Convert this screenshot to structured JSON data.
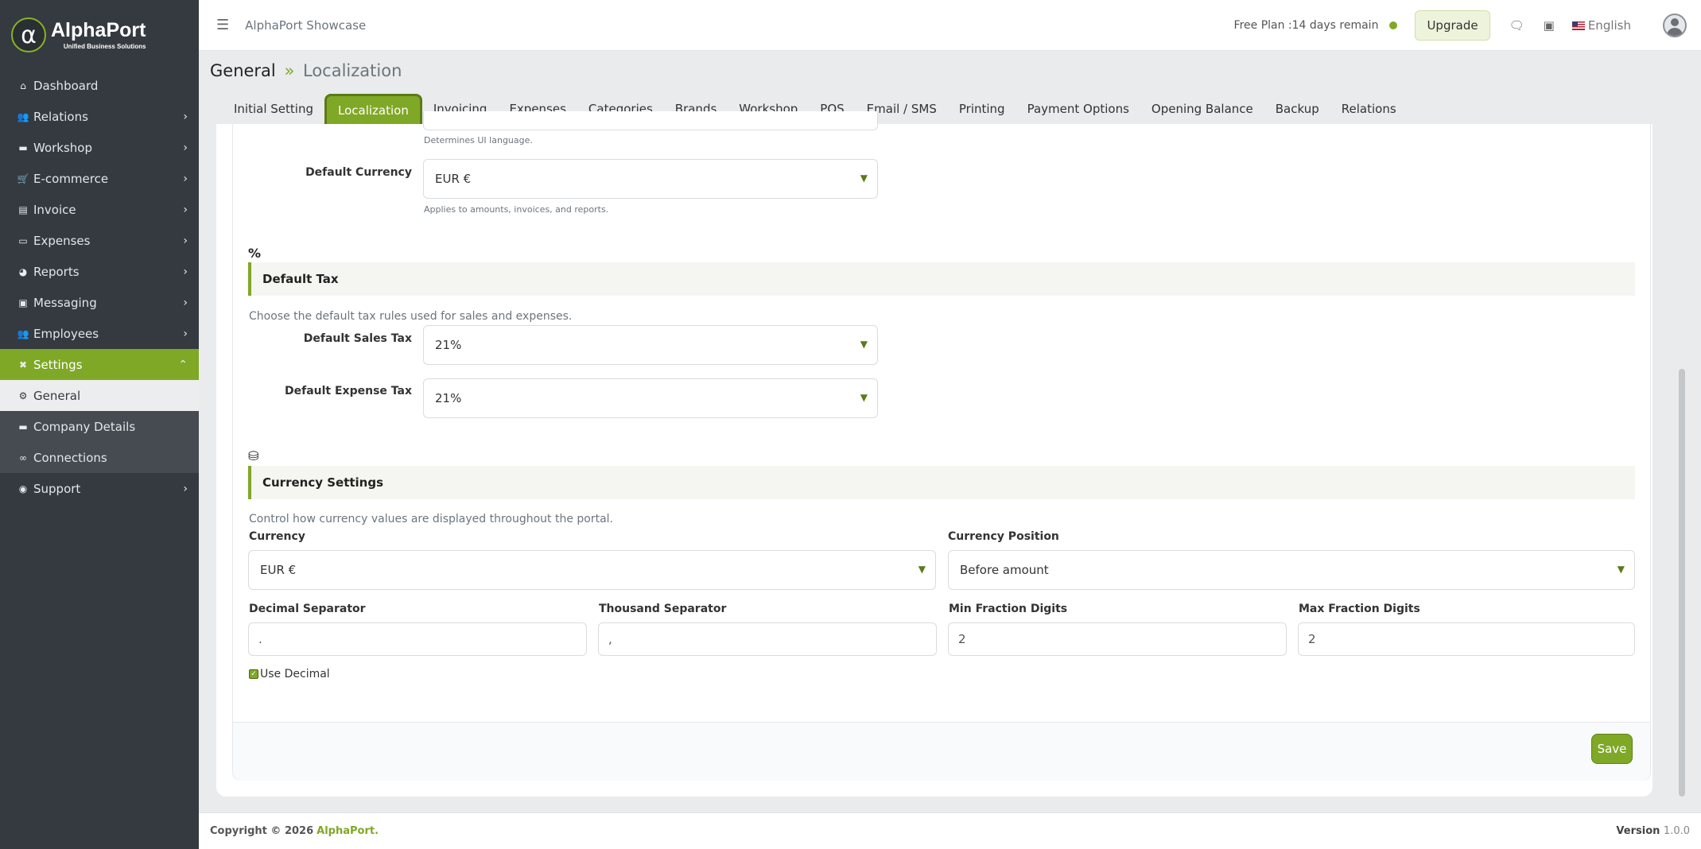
{
  "brand": {
    "title": "AlphaPort",
    "subtitle": "Unified Business Solutions"
  },
  "sidebar": {
    "items": [
      {
        "label": "Dashboard",
        "icon": "home-icon",
        "glyph": "⌂",
        "chevron": false
      },
      {
        "label": "Relations",
        "icon": "users-icon",
        "glyph": "👥",
        "chevron": true
      },
      {
        "label": "Workshop",
        "icon": "briefcase-icon",
        "glyph": "▬",
        "chevron": true
      },
      {
        "label": "E-commerce",
        "icon": "cart-icon",
        "glyph": "🛒",
        "chevron": true
      },
      {
        "label": "Invoice",
        "icon": "document-icon",
        "glyph": "▤",
        "chevron": true
      },
      {
        "label": "Expenses",
        "icon": "money-icon",
        "glyph": "▭",
        "chevron": true
      },
      {
        "label": "Reports",
        "icon": "pie-chart-icon",
        "glyph": "◕",
        "chevron": true
      },
      {
        "label": "Messaging",
        "icon": "message-icon",
        "glyph": "▣",
        "chevron": true
      },
      {
        "label": "Employees",
        "icon": "people-icon",
        "glyph": "👥",
        "chevron": true
      }
    ],
    "settings": {
      "label": "Settings",
      "icon": "tools-icon",
      "glyph": "✖"
    },
    "settings_sub": [
      {
        "label": "General",
        "icon": "gear-icon",
        "glyph": "⚙"
      },
      {
        "label": "Company Details",
        "icon": "briefcase-icon",
        "glyph": "▬"
      },
      {
        "label": "Connections",
        "icon": "link-icon",
        "glyph": "∞"
      }
    ],
    "support": {
      "label": "Support",
      "icon": "lifebuoy-icon",
      "glyph": "◉"
    }
  },
  "topbar": {
    "app_name": "AlphaPort Showcase",
    "plan_text": "Free Plan :14 days remain",
    "upgrade_label": "Upgrade",
    "language": "English"
  },
  "breadcrumb": {
    "parent": "General",
    "separator": "»",
    "current": "Localization"
  },
  "tabs": [
    "Initial Setting",
    "Localization",
    "Invoicing",
    "Expenses",
    "Categories",
    "Brands",
    "Workshop",
    "POS",
    "Email / SMS",
    "Printing",
    "Payment Options",
    "Opening Balance",
    "Backup",
    "Relations"
  ],
  "active_tab": "Localization",
  "form": {
    "language_hint": "Determines UI language.",
    "default_currency": {
      "label": "Default Currency",
      "value": "EUR €",
      "hint": "Applies to amounts, invoices, and reports."
    },
    "default_tax": {
      "icon_glyph": "%",
      "title": "Default Tax",
      "description": "Choose the default tax rules used for sales and expenses.",
      "sales_label": "Default Sales Tax",
      "sales_value": "21%",
      "expense_label": "Default Expense Tax",
      "expense_value": "21%"
    },
    "currency_settings": {
      "icon_glyph": "⛁",
      "title": "Currency Settings",
      "description": "Control how currency values are displayed throughout the portal.",
      "currency_label": "Currency",
      "currency_value": "EUR €",
      "position_label": "Currency Position",
      "position_value": "Before amount",
      "decimal_label": "Decimal Separator",
      "decimal_value": ".",
      "thousand_label": "Thousand Separator",
      "thousand_value": ",",
      "min_label": "Min Fraction Digits",
      "min_value": "2",
      "max_label": "Max Fraction Digits",
      "max_value": "2",
      "use_decimal_label": "Use Decimal",
      "use_decimal_checked": true
    },
    "save_label": "Save"
  },
  "footer": {
    "copyright": "Copyright © 2026",
    "brand": "AlphaPort.",
    "version_label": "Version",
    "version_value": "1.0.0"
  },
  "colors": {
    "accent": "#7fa826",
    "sidebar_bg": "#343a40"
  }
}
